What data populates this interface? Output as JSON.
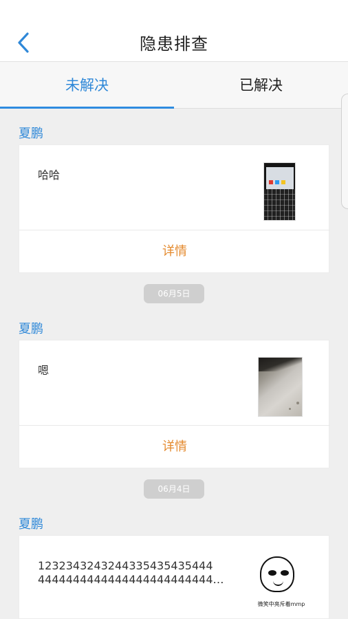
{
  "header": {
    "title": "隐患排查",
    "back_icon": "chevron-left-icon"
  },
  "tabs": [
    {
      "label": "未解决",
      "active": true
    },
    {
      "label": "已解决",
      "active": false
    }
  ],
  "feed": {
    "items": [
      {
        "reporter": "夏鹏",
        "text": "哈哈",
        "image": "laptop-photo",
        "details_label": "详情"
      },
      {
        "reporter": "夏鹏",
        "text": "嗯",
        "image": "floor-photo",
        "details_label": "详情"
      },
      {
        "reporter": "夏鹏",
        "text_lines": [
          "1232343243244335435435444",
          "4444444444444444444444444444..."
        ],
        "image": "meme-image",
        "meme_text": "微笑中亮斥着mmp"
      }
    ],
    "date_badges": [
      "06月5日",
      "06月4日"
    ]
  },
  "colors": {
    "accent": "#2f88d8",
    "details": "#e48a2e"
  }
}
